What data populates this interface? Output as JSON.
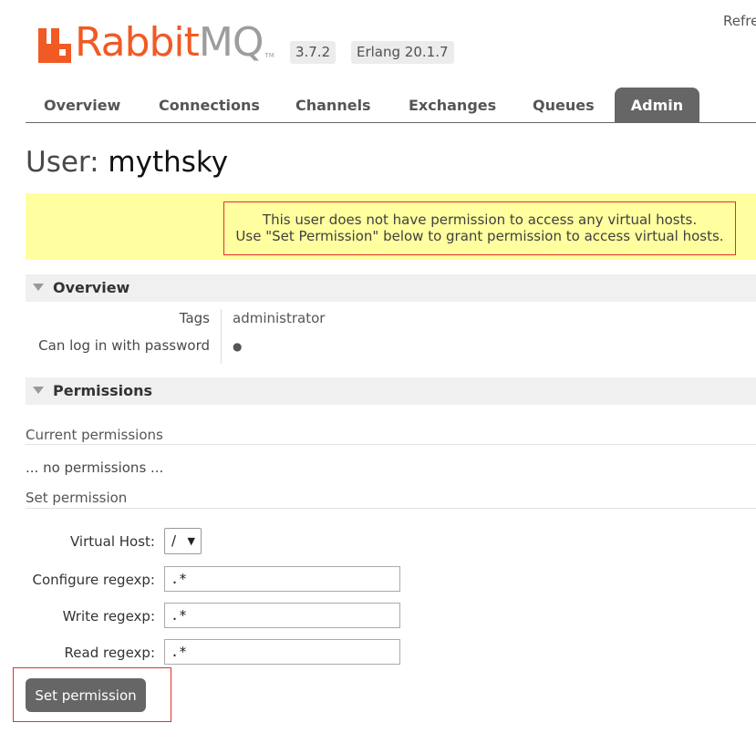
{
  "app": {
    "logo_rabbit": "Rabbit",
    "logo_mq": "MQ",
    "logo_tm": "TM",
    "version": "3.7.2",
    "erlang": "Erlang 20.1.7",
    "refresh_label": "Refre"
  },
  "nav": {
    "tabs": [
      {
        "label": "Overview"
      },
      {
        "label": "Connections"
      },
      {
        "label": "Channels"
      },
      {
        "label": "Exchanges"
      },
      {
        "label": "Queues"
      },
      {
        "label": "Admin",
        "active": true
      }
    ]
  },
  "page": {
    "title_prefix": "User:",
    "username": "mythsky"
  },
  "warning": {
    "line1": "This user does not have permission to access any virtual hosts.",
    "line2": "Use \"Set Permission\" below to grant permission to access virtual hosts."
  },
  "overview": {
    "heading": "Overview",
    "rows": [
      {
        "key": "Tags",
        "value": "administrator"
      },
      {
        "key": "Can log in with password",
        "value": "●"
      }
    ]
  },
  "permissions": {
    "heading": "Permissions",
    "current_title": "Current permissions",
    "empty_text": "... no permissions ...",
    "set_title": "Set permission",
    "form": {
      "vhost_label": "Virtual Host:",
      "vhost_value": "/",
      "configure_label": "Configure regexp:",
      "configure_value": ".*",
      "write_label": "Write regexp:",
      "write_value": ".*",
      "read_label": "Read regexp:",
      "read_value": ".*",
      "submit_label": "Set permission"
    }
  },
  "colors": {
    "brand_orange": "#f15a24",
    "tab_active": "#666666",
    "warning_bg": "#ffff9f",
    "highlight_border": "#e03030"
  }
}
